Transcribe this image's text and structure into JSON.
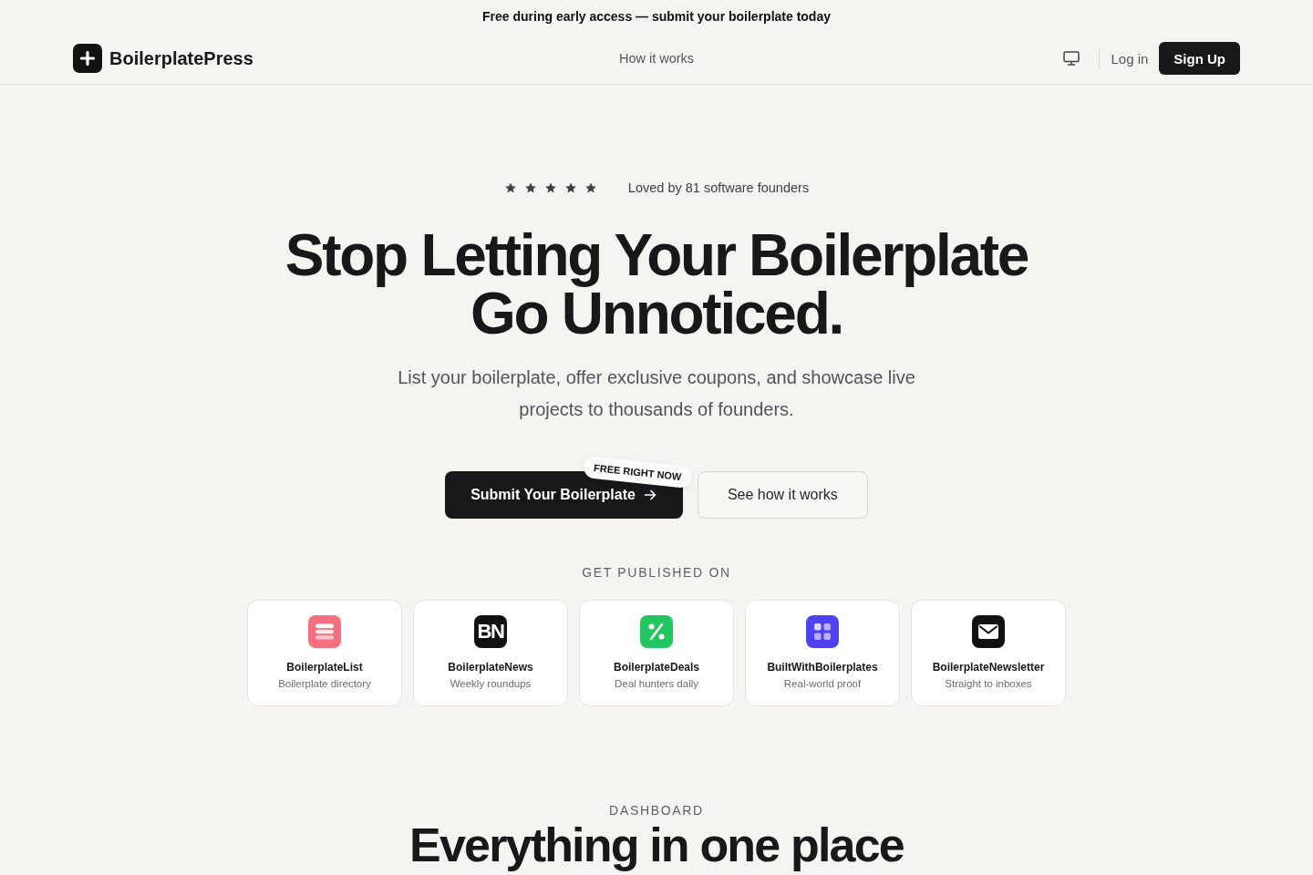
{
  "announcement": {
    "text": "Free during early access — submit your boilerplate today"
  },
  "navbar": {
    "brand": "BoilerplatePress",
    "links": [
      {
        "label": "How it works"
      }
    ],
    "login": "Log in",
    "signup": "Sign Up"
  },
  "hero": {
    "rating": {
      "stars": 5,
      "text": "Loved by 81 software founders"
    },
    "headline": [
      "Stop Letting Your Boilerplate",
      "Go Unnoticed."
    ],
    "subtitle": "List your boilerplate, offer exclusive coupons, and showcase live projects to thousands of founders.",
    "buttons": [
      {
        "label": "Submit Your Boilerplate",
        "kind": "primary"
      },
      {
        "label": "See how it works",
        "kind": "secondary"
      }
    ],
    "badge": "FREE RIGHT NOW"
  },
  "platforms": {
    "heading": "GET PUBLISHED ON",
    "items": [
      {
        "title": "BoilerplateList",
        "subtitle": "Boilerplate directory",
        "icon": {
          "kind": "stack",
          "color": "#f7707f"
        }
      },
      {
        "title": "BoilerplateNews",
        "subtitle": "Weekly roundups",
        "icon": {
          "kind": "monogram",
          "text": "BN",
          "color": "#111111"
        }
      },
      {
        "title": "BoilerplateDeals",
        "subtitle": "Deal hunters daily",
        "icon": {
          "kind": "percent",
          "color": "#22c55e"
        }
      },
      {
        "title": "BuiltWithBoilerplates",
        "subtitle": "Real-world proof",
        "icon": {
          "kind": "grid",
          "color": "#5140f2"
        }
      },
      {
        "title": "BoilerplateNewsletter",
        "subtitle": "Straight to inboxes",
        "icon": {
          "kind": "mail",
          "color": "#111111"
        }
      }
    ]
  },
  "dashboard": {
    "eyebrow": "DASHBOARD",
    "title": "Everything in one place"
  }
}
